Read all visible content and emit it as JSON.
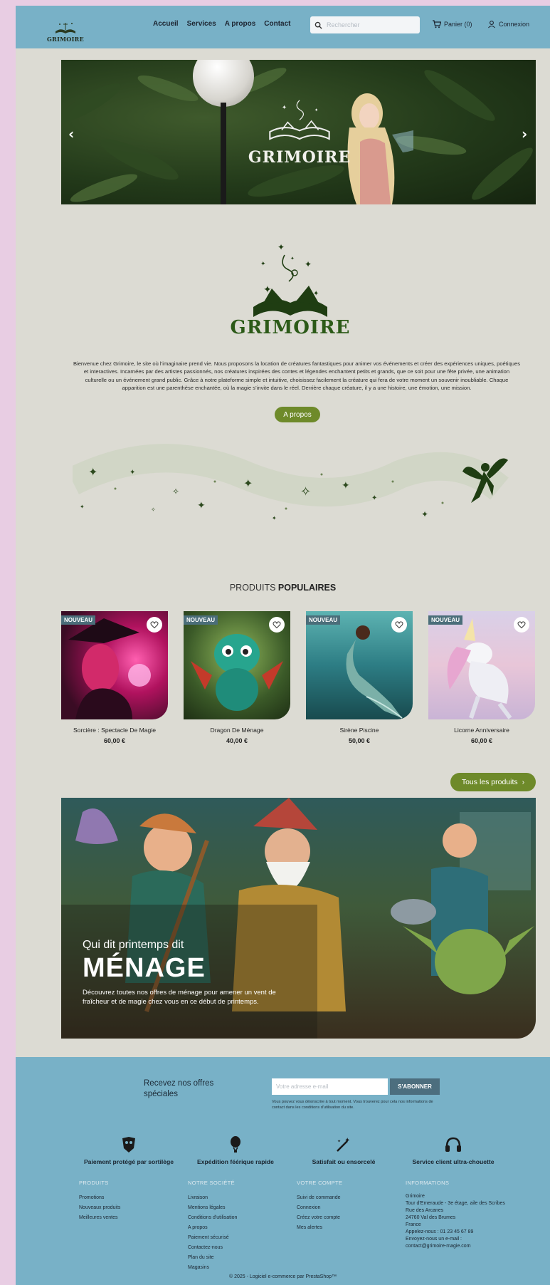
{
  "header": {
    "logo_text": "GRIMOIRE",
    "nav": [
      "Accueil",
      "Services",
      "A propos",
      "Contact"
    ],
    "search_placeholder": "Rechercher",
    "cart_label": "Panier (0)",
    "login_label": "Connexion"
  },
  "hero": {
    "logo_text": "GRIMOIRE",
    "prev": "‹",
    "next": "›"
  },
  "brand": {
    "name": "GRIMOIRE",
    "intro": "Bienvenue chez Grimoire, le site où l’imaginaire prend vie. Nous proposons la location de créatures fantastiques pour animer vos événements et créer des expériences uniques, poétiques et interactives. Incarnées par des artistes passionnés, nos créatures inspirées des contes et légendes enchantent petits et grands, que ce soit pour une fête privée, une animation culturelle ou un événement grand public. Grâce à notre plateforme simple et intuitive, choisissez facilement la créature qui fera de votre moment un souvenir inoubliable. Chaque apparition est une parenthèse enchantée, où la magie s’invite dans le réel. Derrière chaque créature, il y a une histoire, une émotion, une mission.",
    "about_button": "A propos"
  },
  "products": {
    "title_part1": "PRODUITS",
    "title_part2": "POPULAIRES",
    "badge": "NOUVEAU",
    "items": [
      {
        "name": "Sorcière : Spectacle De Magie",
        "price": "60,00 €"
      },
      {
        "name": "Dragon De Ménage",
        "price": "40,00 €"
      },
      {
        "name": "Sirène Piscine",
        "price": "50,00 €"
      },
      {
        "name": "Licorne Anniversaire",
        "price": "60,00 €"
      }
    ],
    "all_button": "Tous les produits",
    "all_arrow": "›"
  },
  "promo": {
    "line1": "Qui dit printemps dit",
    "line2": "MÉNAGE",
    "line3": "Découvrez toutes nos offres de ménage pour amener un vent de fraîcheur et de magie chez vous en ce début de printemps."
  },
  "footer": {
    "newsletter": {
      "label": "Recevez nos offres spéciales",
      "placeholder": "Votre adresse e-mail",
      "button": "S'ABONNER",
      "note": "Vous pouvez vous désinscrire à tout moment. Vous trouverez pour cela nos informations de contact dans les conditions d'utilisation du site."
    },
    "features": [
      "Paiement protégé par sortilège",
      "Expédition féérique rapide",
      "Satisfait ou ensorcelé",
      "Service client ultra-chouette"
    ],
    "columns": [
      {
        "title": "PRODUITS",
        "links": [
          "Promotions",
          "Nouveaux produits",
          "Meilleures ventes"
        ]
      },
      {
        "title": "NOTRE SOCIÉTÉ",
        "links": [
          "Livraison",
          "Mentions légales",
          "Conditions d'utilisation",
          "A propos",
          "Paiement sécurisé",
          "Contactez-nous",
          "Plan du site",
          "Magasins"
        ]
      },
      {
        "title": "VOTRE COMPTE",
        "links": [
          "Suivi de commande",
          "Connexion",
          "Créez votre compte",
          "Mes alertes"
        ]
      }
    ],
    "info": {
      "title": "INFORMATIONS",
      "lines": [
        "Grimoire",
        "Tour d'Emeraude - 3e étage, aile des Scribes",
        "Rue des Arcanes",
        "24760 Val des Brumes",
        "France",
        "Appelez-nous : 01 23 45 67 89",
        "Envoyez-nous un e-mail :",
        "contact@grimoire-magie.com"
      ]
    },
    "copyright": "© 2025 - Logiciel e-commerce par PrestaShop™"
  },
  "colors": {
    "header_bg": "#78b1c7",
    "page_bg": "#dcdbd3",
    "accent_green": "#6e8a2a",
    "brand_green": "#2c5a18",
    "badge_bg": "#4b6e7a"
  }
}
